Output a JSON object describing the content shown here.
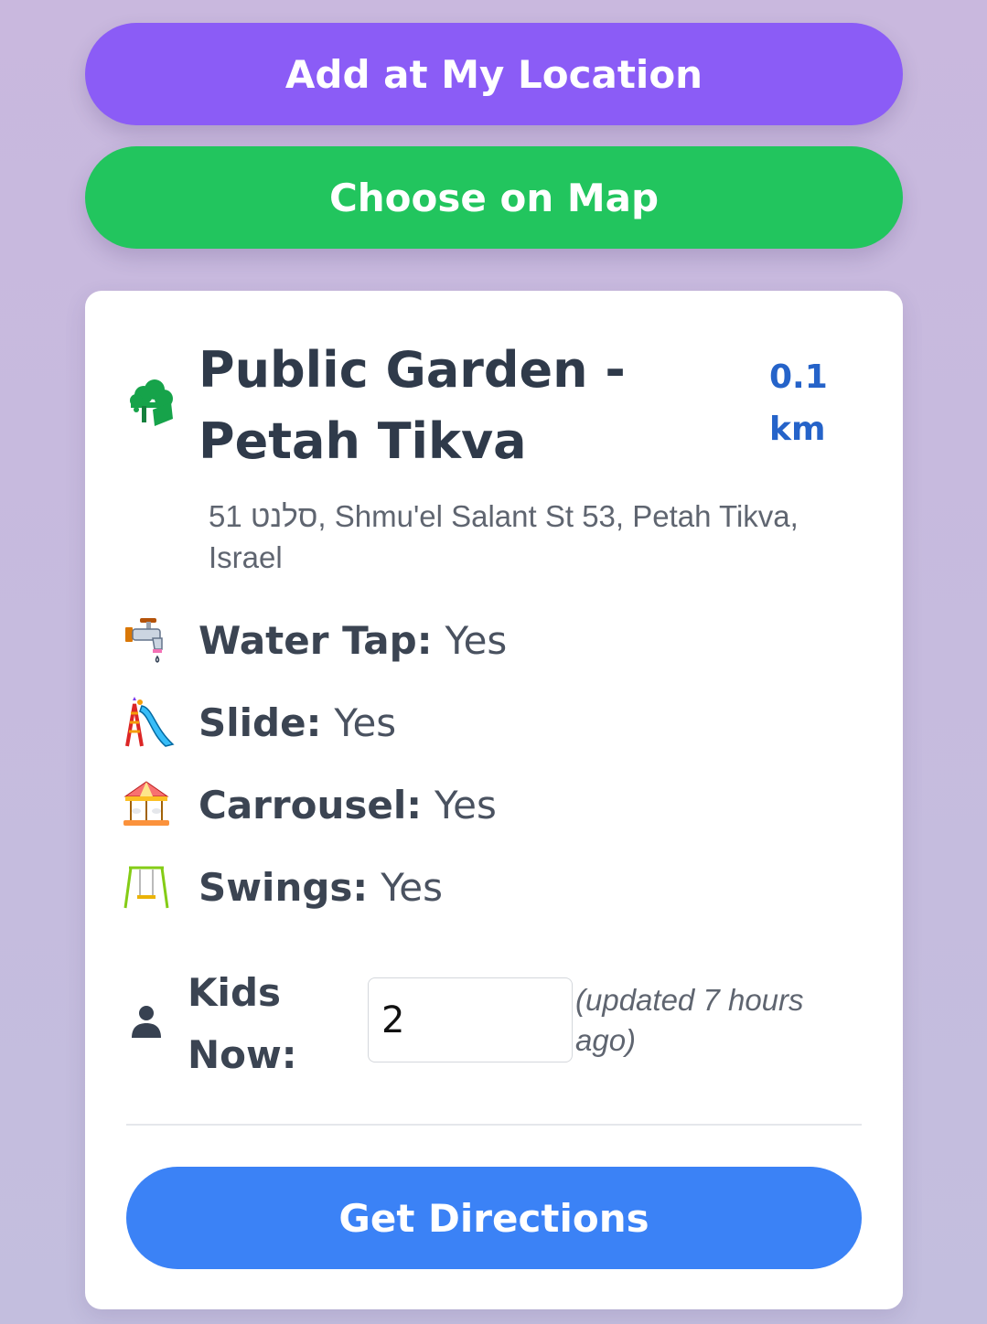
{
  "actions": {
    "add_location_label": "Add at My Location",
    "choose_map_label": "Choose on Map"
  },
  "place": {
    "icon": "park-tree-icon",
    "name": "Public Garden - Petah Tikva",
    "distance": "0.1 km",
    "address": "סלנט 51, Shmu'el Salant St 53, Petah Tikva, Israel"
  },
  "features": [
    {
      "icon": "water-tap-icon",
      "label": "Water Tap:",
      "value": "Yes"
    },
    {
      "icon": "slide-icon",
      "label": "Slide:",
      "value": "Yes"
    },
    {
      "icon": "carousel-icon",
      "label": "Carrousel:",
      "value": "Yes"
    },
    {
      "icon": "swings-icon",
      "label": "Swings:",
      "value": "Yes"
    }
  ],
  "kids": {
    "icon": "person-icon",
    "label": "Kids Now:",
    "value": "2",
    "updated": "(updated 7 hours ago)"
  },
  "directions_label": "Get Directions",
  "colors": {
    "add_button": "#8b5cf6",
    "map_button": "#22c55e",
    "directions_button": "#3b82f6",
    "distance_text": "#2563c9",
    "park_icon": "#16a34a"
  }
}
